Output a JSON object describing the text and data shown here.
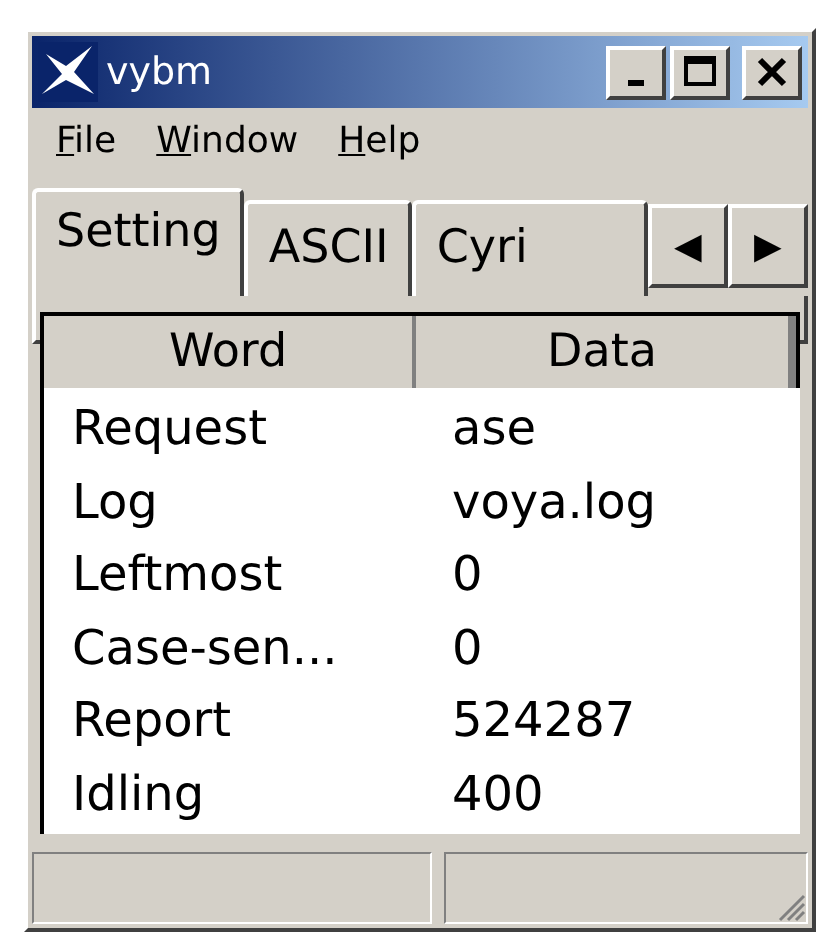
{
  "window": {
    "title": "vybm"
  },
  "menu": [
    "File",
    "Window",
    "Help"
  ],
  "tabs": [
    {
      "label": "Setting",
      "selected": true
    },
    {
      "label": "ASCII",
      "selected": false
    },
    {
      "label": "Cyri",
      "selected": false
    }
  ],
  "tab_scroll": [
    "◀",
    "▶"
  ],
  "table": {
    "columns": [
      "Word",
      "Data"
    ],
    "rows": [
      [
        "Request",
        "ase"
      ],
      [
        "Log",
        "voya.log"
      ],
      [
        "Leftmost",
        "0"
      ],
      [
        "Case-sen...",
        "0"
      ],
      [
        "Report",
        "524287"
      ],
      [
        "Idling",
        "400"
      ]
    ]
  }
}
